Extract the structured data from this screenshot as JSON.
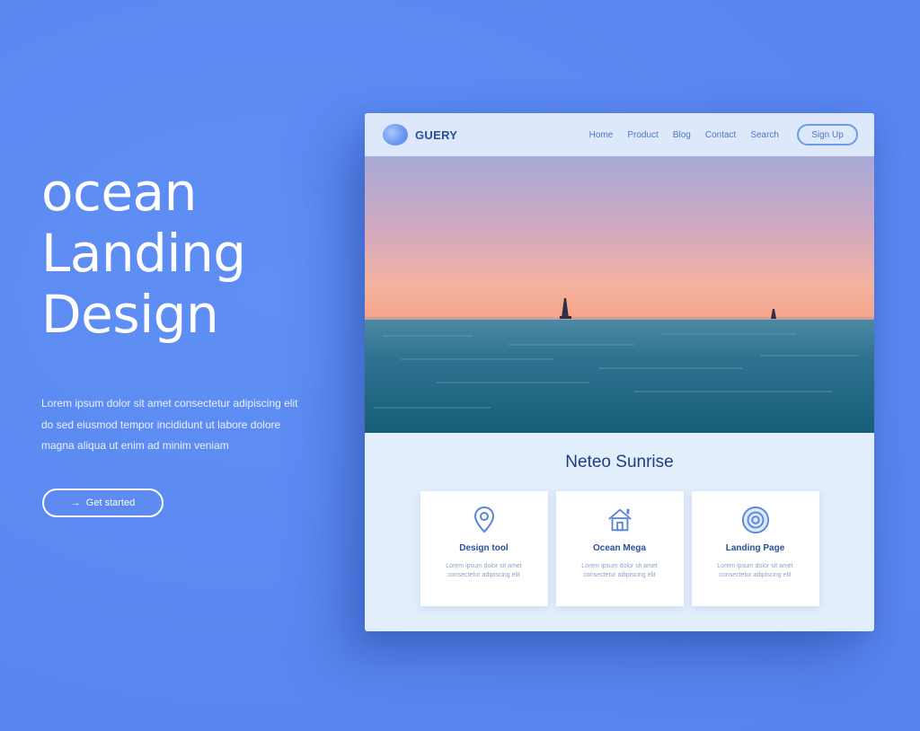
{
  "hero": {
    "headline": [
      "ocean",
      "Landing",
      "Design"
    ],
    "description": "Lorem ipsum dolor sit amet consectetur adipiscing elit do sed eiusmod tempor incididunt ut labore dolore magna aliqua ut enim ad minim veniam",
    "cta_label": "Get started",
    "cta_icon": "arrow-right-icon"
  },
  "mockup": {
    "logo_text": "GUERY",
    "nav_links": [
      "Home",
      "Product",
      "Blog",
      "Contact",
      "Search"
    ],
    "nav_button": "Sign Up",
    "section_title": "Neteo Sunrise",
    "cards": [
      {
        "icon": "location-pin-icon",
        "title": "Design tool",
        "text": "Lorem ipsum dolor sit amet consectetur adipiscing elit"
      },
      {
        "icon": "home-icon",
        "title": "Ocean Mega",
        "text": "Lorem ipsum dolor sit amet consectetur adipiscing elit"
      },
      {
        "icon": "target-icon",
        "title": "Landing Page",
        "text": "Lorem ipsum dolor sit amet consectetur adipiscing elit"
      }
    ]
  },
  "colors": {
    "background": "#5b8af2",
    "accent": "#4f76c6",
    "card_title": "#2a4f9e"
  }
}
